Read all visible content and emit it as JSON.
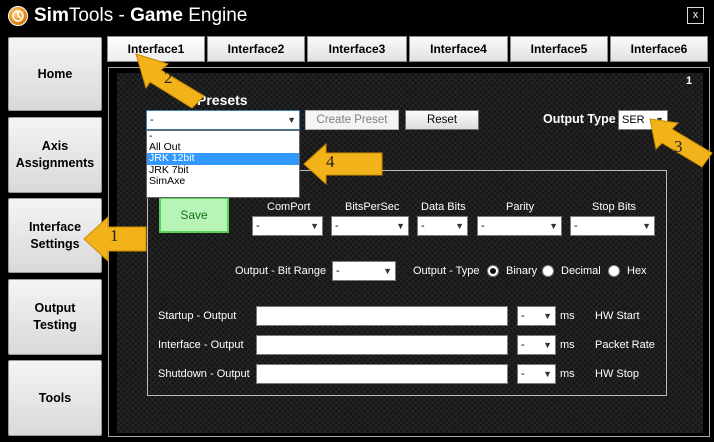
{
  "window": {
    "title_regular": "Sim",
    "title_bold_1": "Tools",
    "title_sep": " - ",
    "title_bold_2": "Game",
    "title_rest": " Engine",
    "close_label": "x"
  },
  "sidebar": {
    "items": [
      {
        "label": "Home"
      },
      {
        "label": "Axis\nAssignments"
      },
      {
        "label": "Interface\nSettings"
      },
      {
        "label": "Output\nTesting"
      },
      {
        "label": "Tools"
      }
    ]
  },
  "tabs": [
    {
      "label": "Interface1"
    },
    {
      "label": "Interface2"
    },
    {
      "label": "Interface3"
    },
    {
      "label": "Interface4"
    },
    {
      "label": "Interface5"
    },
    {
      "label": "Interface6"
    }
  ],
  "panel": {
    "number": "1"
  },
  "presets": {
    "title": "Presets",
    "selected": "-",
    "options": [
      "-",
      "All Out",
      "JRK 12bit",
      "JRK 7bit",
      "SimAxe"
    ],
    "highlighted_index": 2,
    "create_label": "Create Preset",
    "reset_label": "Reset"
  },
  "output_type": {
    "label": "Output Type",
    "value": "SER"
  },
  "save_label": "Save",
  "serial": {
    "comport": {
      "label": "ComPort",
      "value": "-"
    },
    "bitspersec": {
      "label": "BitsPerSec",
      "value": "-"
    },
    "databits": {
      "label": "Data Bits",
      "value": "-"
    },
    "parity": {
      "label": "Parity",
      "value": "-"
    },
    "stopbits": {
      "label": "Stop Bits",
      "value": "-"
    }
  },
  "bit_range": {
    "label": "Output - Bit Range",
    "value": "-"
  },
  "output_format": {
    "label": "Output - Type",
    "options": [
      "Binary",
      "Decimal",
      "Hex"
    ],
    "selected": "Binary"
  },
  "rows": [
    {
      "label": "Startup - Output",
      "interval": "-",
      "unit": "ms",
      "right_label": "HW Start"
    },
    {
      "label": "Interface - Output",
      "interval": "-",
      "unit": "ms",
      "right_label": "Packet Rate"
    },
    {
      "label": "Shutdown - Output",
      "interval": "-",
      "unit": "ms",
      "right_label": "HW Stop"
    }
  ],
  "annotations": [
    "1",
    "2",
    "3",
    "4"
  ],
  "colors": {
    "accent_arrow": "#f2b21a",
    "save_green": "#b6f5b6",
    "selection_blue": "#3399ff"
  }
}
